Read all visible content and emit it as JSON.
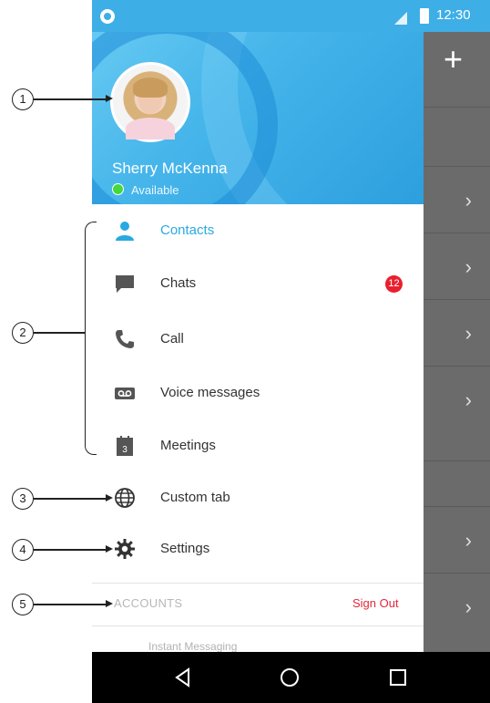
{
  "status_bar": {
    "time": "12:30"
  },
  "profile": {
    "name": "Sherry McKenna",
    "status": "Available"
  },
  "menu": [
    {
      "label": "Contacts",
      "icon": "person-icon",
      "active": true
    },
    {
      "label": "Chats",
      "icon": "chat-bubble-icon",
      "badge": "12"
    },
    {
      "label": "Call",
      "icon": "phone-icon"
    },
    {
      "label": "Voice messages",
      "icon": "voicemail-icon"
    },
    {
      "label": "Meetings",
      "icon": "calendar-icon",
      "calendar_day": "3"
    },
    {
      "label": "Custom tab",
      "icon": "globe-icon"
    },
    {
      "label": "Settings",
      "icon": "gear-icon"
    }
  ],
  "accounts": {
    "label": "ACCOUNTS",
    "sign_out": "Sign Out",
    "item": "Instant Messaging"
  },
  "backdrop": {
    "plus": "+"
  },
  "callouts": [
    "1",
    "2",
    "3",
    "4",
    "5"
  ],
  "colors": {
    "accent": "#29a9e1",
    "badge": "#e8202e",
    "presence": "#43d93c",
    "sign_out": "#e5273a"
  }
}
